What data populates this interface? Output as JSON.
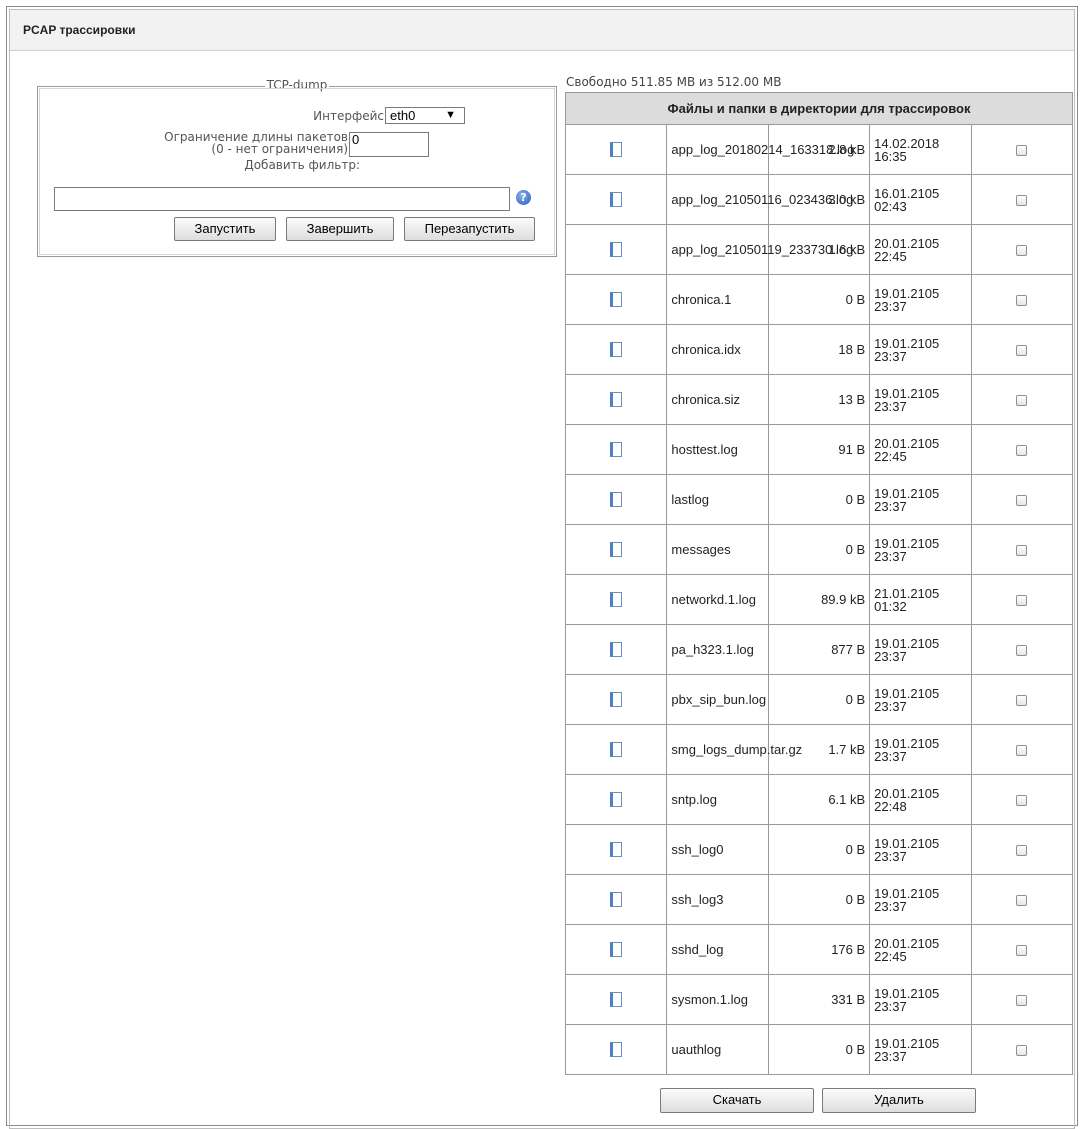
{
  "page": {
    "title": "PCAP трассировки"
  },
  "tcpdump": {
    "legend": "TCP-dump",
    "interface_label": "Интерфейс",
    "interface_value": "eth0",
    "packet_limit_label_1": "Ограничение длины пакетов",
    "packet_limit_label_2": "(0 - нет ограничения)",
    "packet_limit_value": "0",
    "filter_label": "Добавить фильтр:",
    "filter_value": "",
    "help_symbol": "?",
    "buttons": {
      "start": "Запустить",
      "stop": "Завершить",
      "restart": "Перезапустить"
    }
  },
  "files": {
    "free_space": "Свободно 511.85 MB из 512.00 MB",
    "table_header": "Файлы и папки в директории для трассировок",
    "rows": [
      {
        "name": "app_log_20180214_163318.log",
        "size": "2.8 kB",
        "date": "14.02.2018",
        "time": "16:35"
      },
      {
        "name": "app_log_21050116_023436.log",
        "size": "3.0 kB",
        "date": "16.01.2105",
        "time": "02:43"
      },
      {
        "name": "app_log_21050119_233730.log",
        "size": "1.6 kB",
        "date": "20.01.2105",
        "time": "22:45"
      },
      {
        "name": "chronica.1",
        "size": "0 B",
        "date": "19.01.2105",
        "time": "23:37"
      },
      {
        "name": "chronica.idx",
        "size": "18 B",
        "date": "19.01.2105",
        "time": "23:37"
      },
      {
        "name": "chronica.siz",
        "size": "13 B",
        "date": "19.01.2105",
        "time": "23:37"
      },
      {
        "name": "hosttest.log",
        "size": "91 B",
        "date": "20.01.2105",
        "time": "22:45"
      },
      {
        "name": "lastlog",
        "size": "0 B",
        "date": "19.01.2105",
        "time": "23:37"
      },
      {
        "name": "messages",
        "size": "0 B",
        "date": "19.01.2105",
        "time": "23:37"
      },
      {
        "name": "networkd.1.log",
        "size": "89.9 kB",
        "date": "21.01.2105",
        "time": "01:32"
      },
      {
        "name": "pa_h323.1.log",
        "size": "877 B",
        "date": "19.01.2105",
        "time": "23:37"
      },
      {
        "name": "pbx_sip_bun.log",
        "size": "0 B",
        "date": "19.01.2105",
        "time": "23:37"
      },
      {
        "name": "smg_logs_dump.tar.gz",
        "size": "1.7 kB",
        "date": "19.01.2105",
        "time": "23:37"
      },
      {
        "name": "sntp.log",
        "size": "6.1 kB",
        "date": "20.01.2105",
        "time": "22:48"
      },
      {
        "name": "ssh_log0",
        "size": "0 B",
        "date": "19.01.2105",
        "time": "23:37"
      },
      {
        "name": "ssh_log3",
        "size": "0 B",
        "date": "19.01.2105",
        "time": "23:37"
      },
      {
        "name": "sshd_log",
        "size": "176 B",
        "date": "20.01.2105",
        "time": "22:45"
      },
      {
        "name": "sysmon.1.log",
        "size": "331 B",
        "date": "19.01.2105",
        "time": "23:37"
      },
      {
        "name": "uauthlog",
        "size": "0 B",
        "date": "19.01.2105",
        "time": "23:37"
      }
    ],
    "buttons": {
      "download": "Скачать",
      "delete": "Удалить"
    }
  }
}
